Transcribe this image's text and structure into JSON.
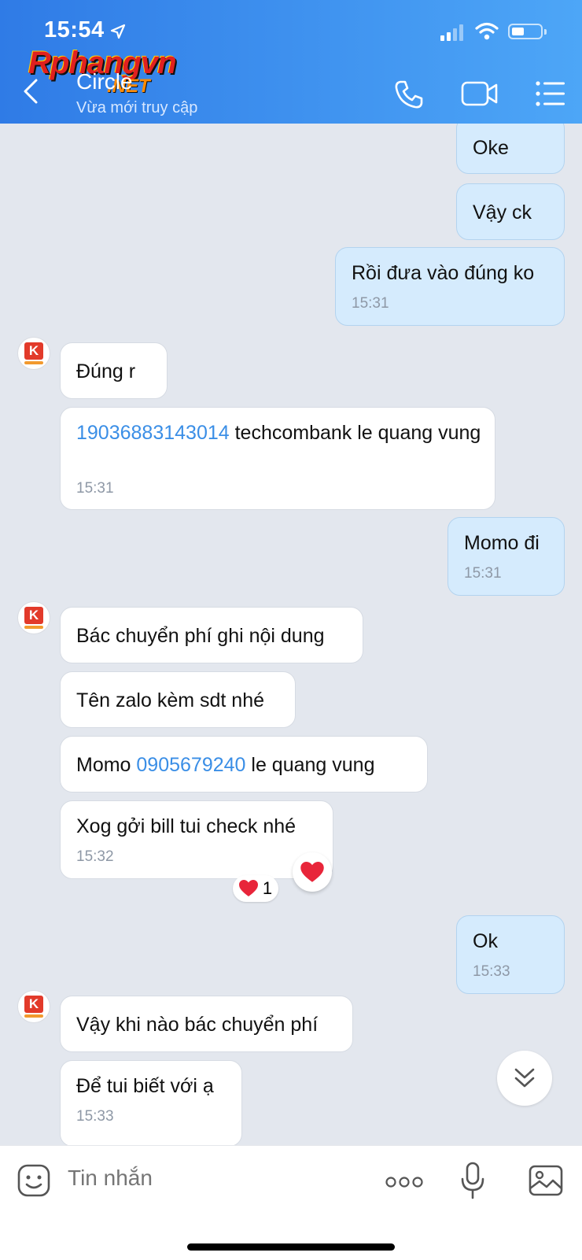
{
  "status": {
    "time": "15:54"
  },
  "header": {
    "title": "Circle",
    "subtitle": "Vừa mới truy cập"
  },
  "watermark": {
    "main": "Rphangvn",
    "suffix": ".NET"
  },
  "messages": [
    {
      "dir": "out",
      "text": "Oke"
    },
    {
      "dir": "out",
      "text": "Vậy ck"
    },
    {
      "dir": "out",
      "text": "Rồi đưa vào đúng ko",
      "time": "15:31"
    },
    {
      "dir": "in",
      "text": "Đúng r"
    },
    {
      "dir": "in",
      "link": "19036883143014",
      "rest": " techcombank le quang vung",
      "time": "15:31"
    },
    {
      "dir": "out",
      "text": "Momo đi",
      "time": "15:31"
    },
    {
      "dir": "in",
      "text": "Bác chuyển phí ghi nội dung"
    },
    {
      "dir": "in",
      "text": "Tên zalo kèm sdt nhé"
    },
    {
      "dir": "in",
      "prefix": "Momo ",
      "link": "0905679240",
      "rest": " le quang vung"
    },
    {
      "dir": "in",
      "text": "Xog gởi bill tui check nhé",
      "time": "15:32",
      "reaction_count": "1"
    },
    {
      "dir": "out",
      "text": "Ok",
      "time": "15:33"
    },
    {
      "dir": "in",
      "text": "Vậy khi nào bác chuyển phí"
    },
    {
      "dir": "in",
      "text": "Để tui biết với ạ",
      "time": "15:33"
    }
  ],
  "input": {
    "placeholder": "Tin nhắn"
  },
  "colors": {
    "header_start": "#2f7be6",
    "header_end": "#4da6f7",
    "out_bubble": "#d5ebfd",
    "in_bubble": "#ffffff",
    "link": "#3a8ee6",
    "background": "#e3e7ee"
  }
}
